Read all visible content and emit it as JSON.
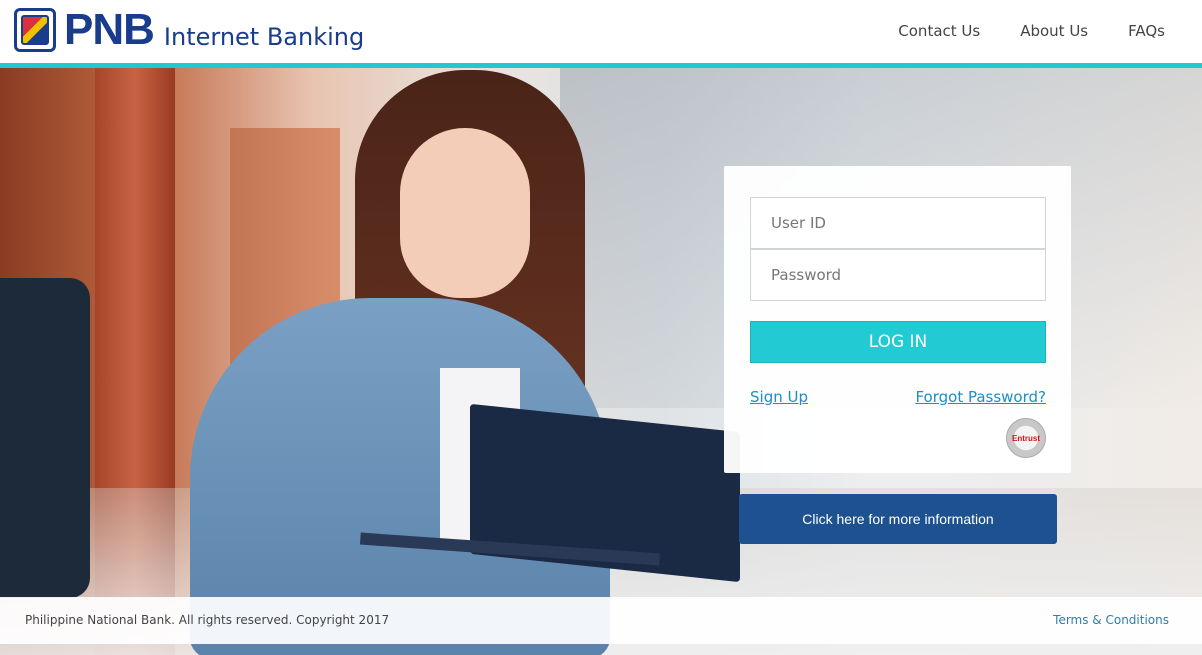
{
  "brand": {
    "name": "PNB",
    "subtitle": "Internet Banking",
    "primary_color": "#1a3c8c",
    "accent_color": "#22c7d1"
  },
  "nav": {
    "items": [
      {
        "label": "Contact Us"
      },
      {
        "label": "About Us"
      },
      {
        "label": "FAQs"
      }
    ]
  },
  "login": {
    "user_id_placeholder": "User ID",
    "user_id_value": "",
    "password_placeholder": "Password",
    "password_value": "",
    "login_label": "LOG IN",
    "signup_label": "Sign Up",
    "forgot_label": "Forgot Password?",
    "seal_text": "Entrust",
    "button_color": "#22cbd4"
  },
  "info": {
    "button_label": "Click here for more information",
    "button_color": "#1d5190"
  },
  "footer": {
    "copyright": "Philippine National Bank. All rights reserved. Copyright 2017",
    "terms_label": "Terms & Conditions"
  },
  "icons": {
    "logo": "pnb-seal-icon",
    "trust_seal": "entrust-seal-icon"
  }
}
